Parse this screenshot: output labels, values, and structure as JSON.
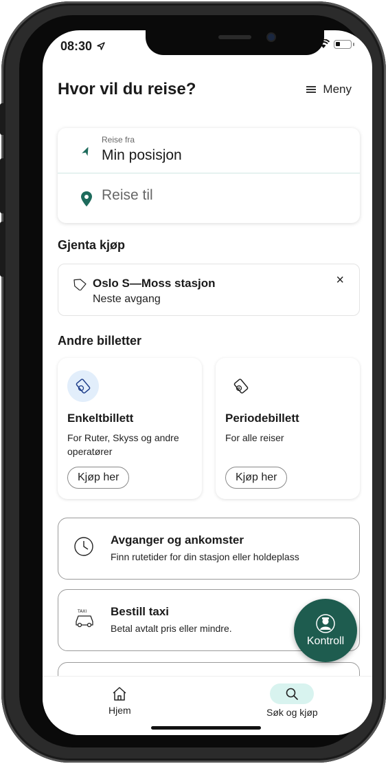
{
  "status": {
    "time": "08:30"
  },
  "header": {
    "title": "Hvor vil du reise?",
    "menu_label": "Meny"
  },
  "search": {
    "from_label": "Reise fra",
    "from_value": "Min posisjon",
    "to_placeholder": "Reise til"
  },
  "repeat": {
    "section_title": "Gjenta kjøp",
    "route": "Oslo S—Moss stasjon",
    "next": "Neste avgang",
    "close_icon": "×"
  },
  "tickets": {
    "section_title": "Andre billetter",
    "items": [
      {
        "name": "Enkeltbillett",
        "desc": "For Ruter, Skyss og andre operatører",
        "button": "Kjøp her",
        "icon": "ticket-single-icon"
      },
      {
        "name": "Periodebillett",
        "desc": "For alle reiser",
        "button": "Kjøp her",
        "icon": "ticket-period-icon"
      }
    ]
  },
  "rows": [
    {
      "title": "Avganger og ankomster",
      "subtitle": "Finn rutetider for din stasjon eller holdeplass",
      "icon": "clock-icon"
    },
    {
      "title": "Bestill taxi",
      "subtitle": "Betal avtalt pris eller mindre.",
      "icon": "taxi-icon"
    }
  ],
  "fab": {
    "label": "Kontroll",
    "icon": "inspector-icon"
  },
  "tabbar": {
    "items": [
      {
        "label": "Hjem",
        "icon": "home-icon"
      },
      {
        "label": "Søk og kjøp",
        "icon": "search-icon",
        "active": true
      }
    ]
  },
  "colors": {
    "accent": "#1e5c4f",
    "accent_light": "#d8f3ef",
    "icon_green": "#1e6b5c"
  }
}
